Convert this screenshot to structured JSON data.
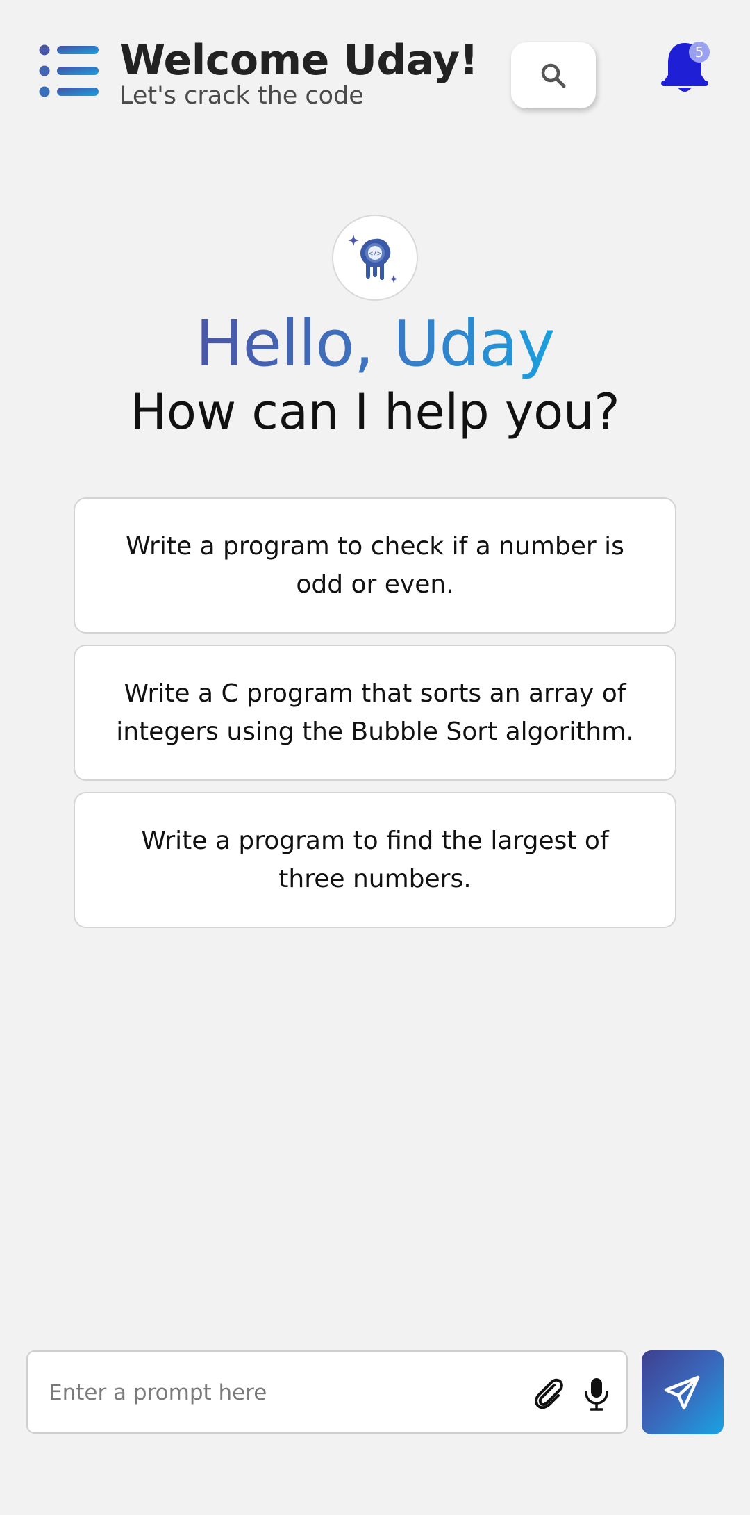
{
  "header": {
    "title": "Welcome Uday!",
    "subtitle": "Let's crack the code",
    "notification_count": "5"
  },
  "greeting": {
    "hello": "Hello, Uday",
    "question": "How can I help you?"
  },
  "suggestions": [
    "Write a program to check if a number is odd or even.",
    "Write a C program that sorts an array of integers using the Bubble Sort algorithm.",
    "Write a program to find the largest of three numbers."
  ],
  "prompt": {
    "placeholder": "Enter a prompt here",
    "value": ""
  },
  "icons": {
    "menu": "menu-icon",
    "search": "search-icon",
    "bell": "bell-icon",
    "logo": "code-badge-logo",
    "attach": "paperclip-icon",
    "mic": "microphone-icon",
    "send": "paper-plane-icon"
  },
  "colors": {
    "background": "#f2f2f2",
    "bell": "#1f1fd6",
    "badge": "#9aa1f0",
    "gradient_start": "#4a56a6",
    "gradient_end": "#1a9fde"
  }
}
